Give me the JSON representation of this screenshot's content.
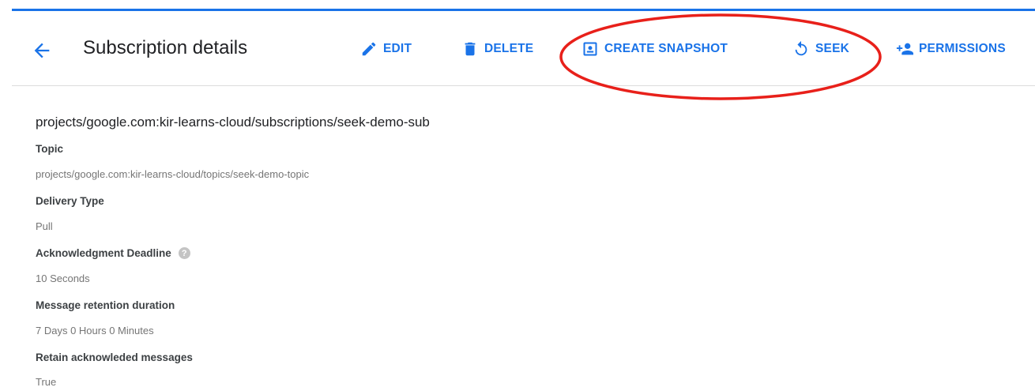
{
  "header": {
    "title": "Subscription details",
    "actions": {
      "edit": "EDIT",
      "delete": "DELETE",
      "create_snapshot": "CREATE SNAPSHOT",
      "seek": "SEEK",
      "permissions": "PERMISSIONS"
    }
  },
  "subscription": {
    "name": "projects/google.com:kir-learns-cloud/subscriptions/seek-demo-sub",
    "fields": [
      {
        "label": "Topic",
        "value": "projects/google.com:kir-learns-cloud/topics/seek-demo-topic"
      },
      {
        "label": "Delivery Type",
        "value": "Pull"
      },
      {
        "label": "Acknowledgment Deadline",
        "value": "10 Seconds",
        "help_icon": "help-icon"
      },
      {
        "label": "Message retention duration",
        "value": "7 Days 0 Hours 0 Minutes"
      },
      {
        "label": "Retain acknowleded messages",
        "value": "True"
      }
    ]
  },
  "icons": {
    "back": "arrow-back-icon",
    "edit": "pencil-icon",
    "delete": "trash-icon",
    "create_snapshot": "snapshot-icon",
    "seek": "rewind-icon",
    "permissions": "person-add-icon"
  },
  "colors": {
    "accent": "#1a73e8",
    "annotation": "#e8201a",
    "label": "#3c4043",
    "value": "#757575"
  }
}
